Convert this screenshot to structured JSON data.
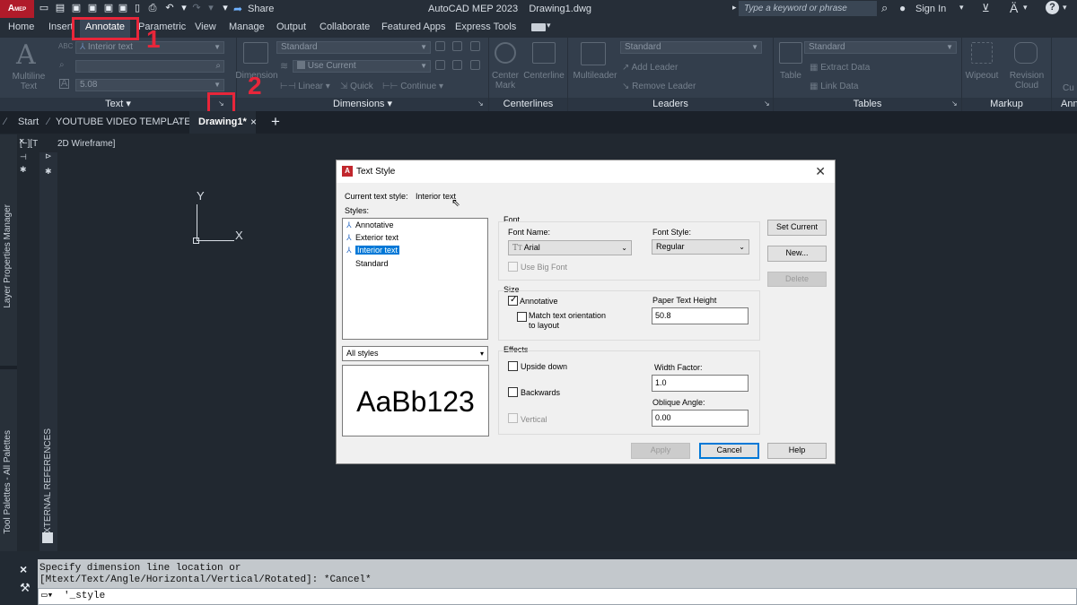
{
  "app": {
    "logo": "A",
    "logo_sub": "MEP",
    "title": "AutoCAD MEP 2023",
    "filename": "Drawing1.dwg",
    "share": "Share",
    "search_placeholder": "Type a keyword or phrase",
    "sign_in": "Sign In",
    "brand_color": "#b01b2a"
  },
  "menu": {
    "tabs": [
      "Home",
      "Insert",
      "Annotate",
      "Parametric",
      "View",
      "Manage",
      "Output",
      "Collaborate",
      "Featured Apps",
      "Express Tools"
    ],
    "active": "Annotate"
  },
  "ribbon": {
    "text_panel": {
      "title": "Text",
      "multiline_line1": "Multiline",
      "multiline_line2": "Text",
      "style_value": "Interior text",
      "height_value": "5.08"
    },
    "dimensions_panel": {
      "title": "Dimensions",
      "dimension_label": "Dimension",
      "style_value": "Standard",
      "layer_value": "Use Current",
      "linear": "Linear",
      "quick": "Quick",
      "continue": "Continue"
    },
    "centerlines_panel": {
      "title": "Centerlines",
      "center_mark_1": "Center",
      "center_mark_2": "Mark",
      "centerline": "Centerline"
    },
    "leaders_panel": {
      "title": "Leaders",
      "multileader": "Multileader",
      "style_value": "Standard",
      "add_leader": "Add Leader",
      "remove_leader": "Remove Leader"
    },
    "tables_panel": {
      "title": "Tables",
      "table": "Table",
      "style_value": "Standard",
      "extract_data": "Extract Data",
      "link_data": "Link Data"
    },
    "markup_panel": {
      "title": "Markup",
      "wipeout": "Wipeout",
      "revision_1": "Revision",
      "revision_2": "Cloud"
    },
    "extra_panel": {
      "title": "Ann",
      "cut": "Cu"
    }
  },
  "doc_tabs": [
    "Start",
    "YOUTUBE VIDEO TEMPLATE*",
    "Drawing1*"
  ],
  "doc_tab_active": "Drawing1*",
  "viewport": {
    "label_prefix": "[−][T",
    "label": "2D Wireframe]",
    "axis_y": "Y",
    "axis_x": "X"
  },
  "palettes": {
    "layer_props": "Layer Properties Manager",
    "tool_palettes": "Tool Palettes - All Palettes",
    "external_refs": "EXTERNAL REFERENCES"
  },
  "command": {
    "line1": "Specify dimension line location or",
    "line2": "[Mtext/Text/Angle/Horizontal/Vertical/Rotated]: *Cancel*",
    "input": "'_style"
  },
  "dialog": {
    "title": "Text Style",
    "current_label": "Current text style:",
    "current_value": "Interior text",
    "styles_label": "Styles:",
    "styles": [
      {
        "name": "Annotative",
        "annotative": true,
        "selected": false
      },
      {
        "name": "Exterior text",
        "annotative": true,
        "selected": false
      },
      {
        "name": "Interior text",
        "annotative": true,
        "selected": true
      },
      {
        "name": "Standard",
        "annotative": false,
        "selected": false
      }
    ],
    "filter_value": "All styles",
    "preview_text": "AaBb123",
    "font_group": "Font",
    "font_name_label": "Font Name:",
    "font_name_value": "Arial",
    "font_style_label": "Font Style:",
    "font_style_value": "Regular",
    "use_big_font": "Use Big Font",
    "size_group": "Size",
    "annotative_label": "Annotative",
    "annotative_checked": true,
    "match_orientation_1": "Match text orientation",
    "match_orientation_2": "to layout",
    "paper_height_label": "Paper Text Height",
    "paper_height_value": "50.8",
    "effects_group": "Effects",
    "upside_down": "Upside down",
    "backwards": "Backwards",
    "vertical": "Vertical",
    "width_factor_label": "Width Factor:",
    "width_factor_value": "1.0",
    "oblique_label": "Oblique Angle:",
    "oblique_value": "0.00",
    "buttons": {
      "set_current": "Set Current",
      "new": "New...",
      "delete": "Delete",
      "apply": "Apply",
      "cancel": "Cancel",
      "help": "Help"
    }
  },
  "annotations": {
    "step1": "1",
    "step2": "2",
    "color": "#e8263a"
  }
}
